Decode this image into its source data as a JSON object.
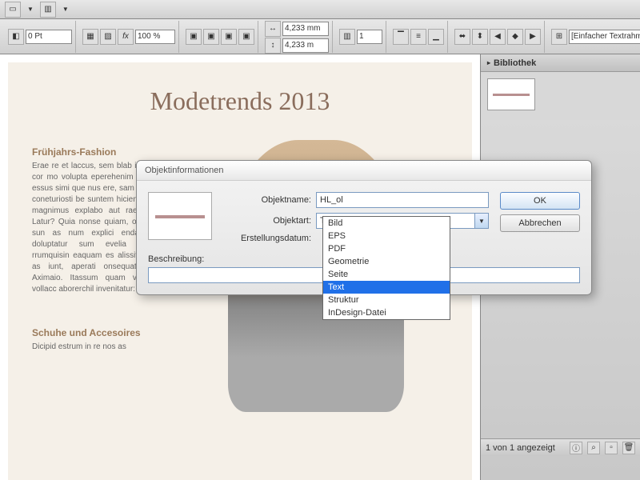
{
  "toolbar": {
    "stroke_value": "0 Pt",
    "opacity": "100 %",
    "w_value": "4,233 mm",
    "h_value": "4,233 m",
    "cols_value": "1",
    "frame_type": "[Einfacher Textrahmen]"
  },
  "document": {
    "title": "Modetrends 2013",
    "section1_heading": "Frühjahrs-Fashion",
    "section1_body": "Erae re et laccus, sem blab invelecus cor mo volupta eperehenim aecerum essus simi que nus ere, sam ad ment, coneturiosti be suntem hiciend elis as magnimus explabo aut rae laccus.\nLatur? Quia nonse quiam, omnistius, sun as num explici endae atius doluptatur sum evelia venimpe rrumquisin eaquam es alissit atquam as iunt, aperati onsequatum vel.\nAximaio. Itassum quam volum et vollacc aborerchil invenitatur:",
    "section2_heading": "Schuhe und Accesoires",
    "section2_body": "Dicipid estrum in re nos as"
  },
  "panel": {
    "title": "Bibliothek",
    "status": "1 von 1 angezeigt"
  },
  "dialog": {
    "title": "Objektinformationen",
    "labels": {
      "name": "Objektname:",
      "type": "Objektart:",
      "date": "Erstellungsdatum:",
      "desc": "Beschreibung:"
    },
    "values": {
      "name": "HL_ol",
      "type": "Text"
    },
    "buttons": {
      "ok": "OK",
      "cancel": "Abbrechen"
    },
    "dropdown_options": [
      "Bild",
      "EPS",
      "PDF",
      "Geometrie",
      "Seite",
      "Text",
      "Struktur",
      "InDesign-Datei"
    ],
    "dropdown_selected": "Text"
  }
}
